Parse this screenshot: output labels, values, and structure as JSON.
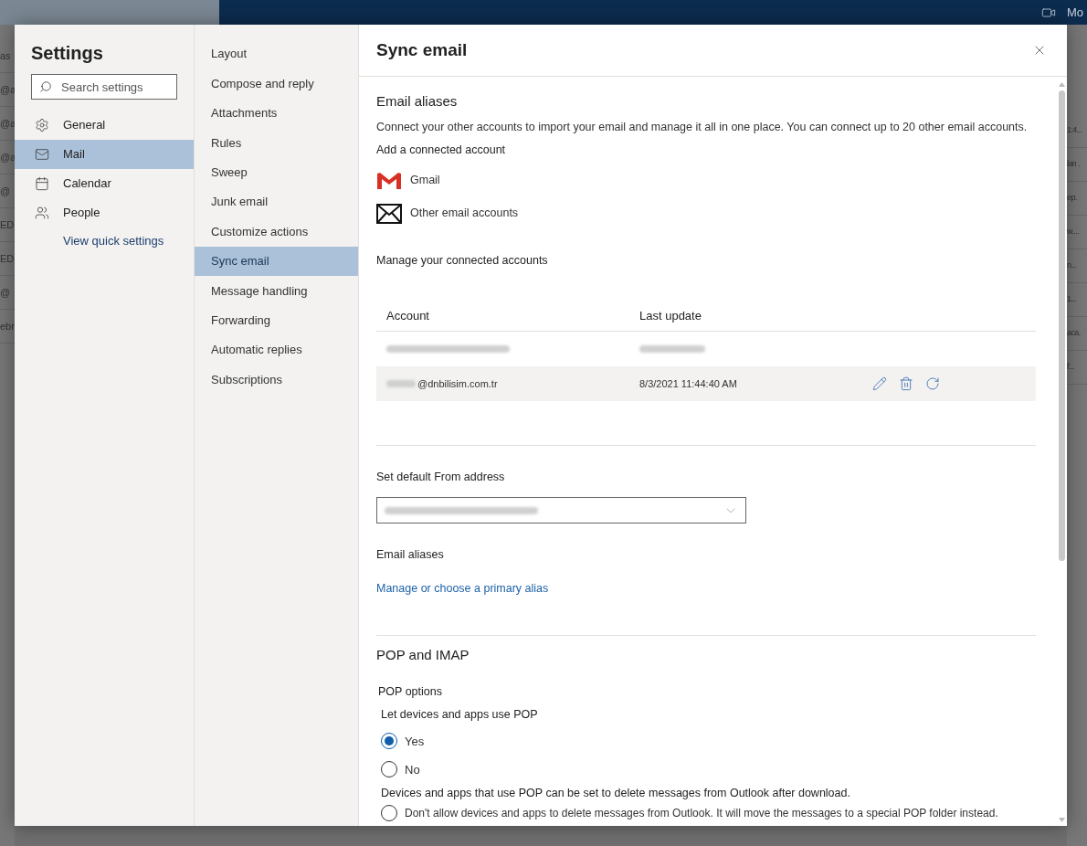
{
  "backdrop": {
    "top_bar_text": "Mo",
    "left_fragments": [
      "as",
      "@a",
      "@a",
      "@a",
      "@",
      "ED",
      "ED",
      "@",
      "ebr"
    ],
    "right_fragments": [
      "1:4...",
      "ları .",
      "ep.",
      "w....",
      "n...",
      "1...",
      "aca.",
      "f..."
    ]
  },
  "settings": {
    "title": "Settings",
    "search": {
      "placeholder": "Search settings"
    },
    "categories": [
      {
        "label": "General",
        "kind": "gear",
        "selected": false
      },
      {
        "label": "Mail",
        "kind": "mail",
        "selected": true
      },
      {
        "label": "Calendar",
        "kind": "calendar",
        "selected": false
      },
      {
        "label": "People",
        "kind": "people",
        "selected": false
      }
    ],
    "quick_settings_link": "View quick settings"
  },
  "subnav": [
    {
      "label": "Layout",
      "selected": false
    },
    {
      "label": "Compose and reply",
      "selected": false
    },
    {
      "label": "Attachments",
      "selected": false
    },
    {
      "label": "Rules",
      "selected": false
    },
    {
      "label": "Sweep",
      "selected": false
    },
    {
      "label": "Junk email",
      "selected": false
    },
    {
      "label": "Customize actions",
      "selected": false
    },
    {
      "label": "Sync email",
      "selected": true
    },
    {
      "label": "Message handling",
      "selected": false
    },
    {
      "label": "Forwarding",
      "selected": false
    },
    {
      "label": "Automatic replies",
      "selected": false
    },
    {
      "label": "Subscriptions",
      "selected": false
    }
  ],
  "panel": {
    "title": "Sync email",
    "aliases_heading": "Email aliases",
    "description": "Connect your other accounts to import your email and manage it all in one place. You can connect up to 20 other email accounts.",
    "add_heading": "Add a connected account",
    "providers": [
      {
        "label": "Gmail",
        "kind": "gmail"
      },
      {
        "label": "Other email accounts",
        "kind": "envelope"
      }
    ],
    "manage_heading": "Manage your connected accounts",
    "table": {
      "columns": [
        "Account",
        "Last update"
      ],
      "rows": [
        {
          "account": "",
          "last_update": "",
          "redacted": true,
          "selected": false
        },
        {
          "account": "@dnbilisim.com.tr",
          "last_update": "8/3/2021 11:44:40 AM",
          "redacted": false,
          "selected": true
        }
      ]
    },
    "default_from_label": "Set default From address",
    "aliases_label": "Email aliases",
    "aliases_link": "Manage or choose a primary alias",
    "pop_heading": "POP and IMAP",
    "pop_options_label": "POP options",
    "pop_question": "Let devices and apps use POP",
    "pop_choices": [
      {
        "label": "Yes",
        "selected": true
      },
      {
        "label": "No",
        "selected": false
      }
    ],
    "delete_note": "Devices and apps that use POP can be set to delete messages from Outlook after download.",
    "delete_choices": [
      {
        "label": "Don't allow devices and apps to delete messages from Outlook. It will move the messages to a special POP folder instead.",
        "selected": false
      }
    ]
  }
}
